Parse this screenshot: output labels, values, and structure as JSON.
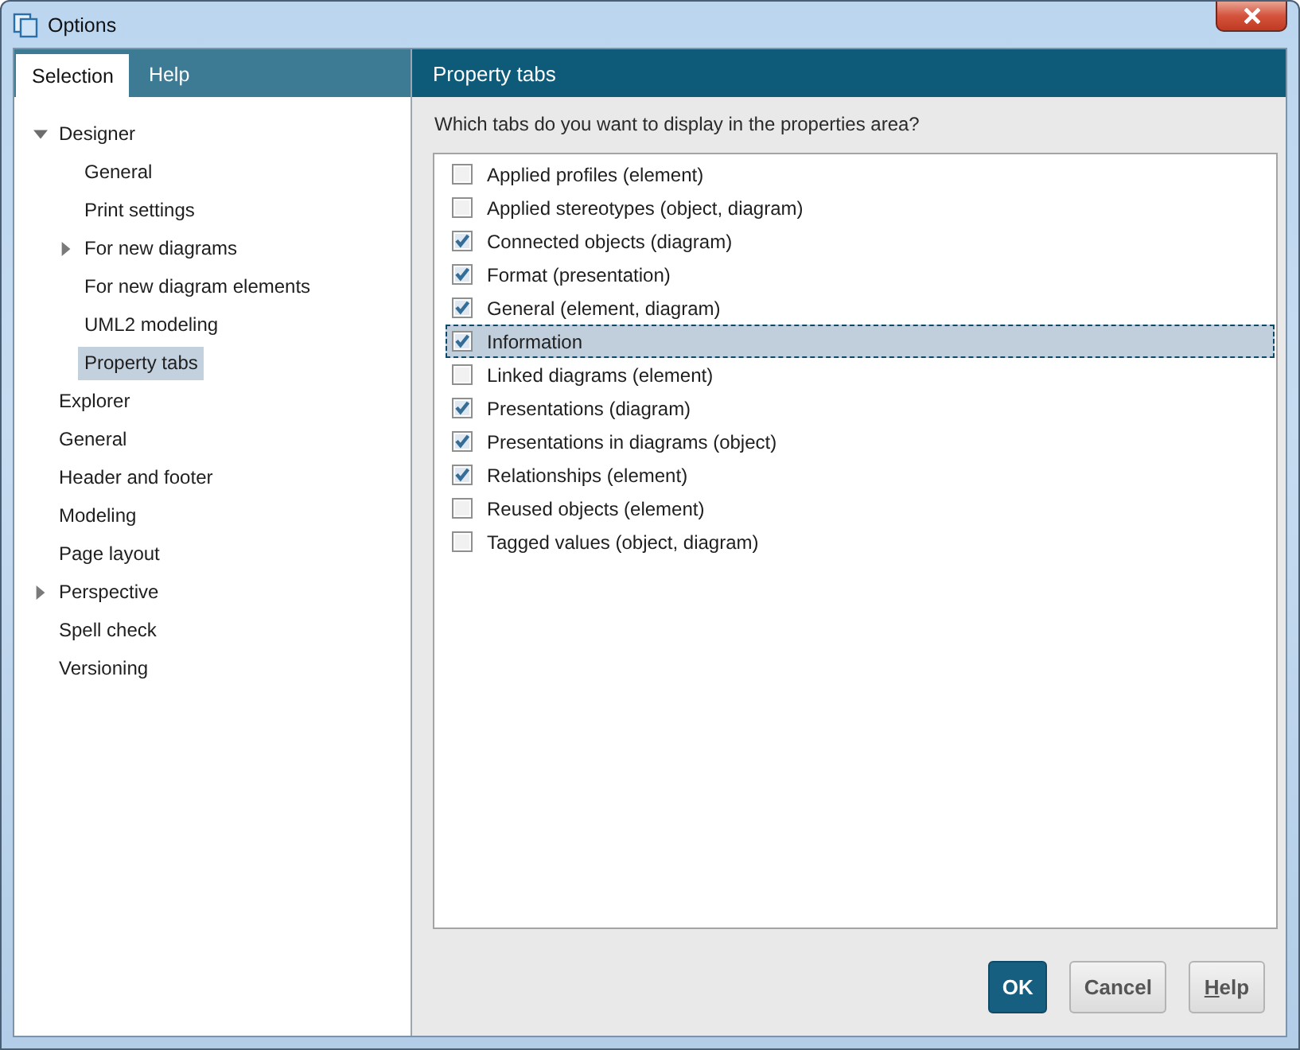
{
  "window": {
    "title": "Options"
  },
  "left_tabs": [
    {
      "label": "Selection",
      "selected": true
    },
    {
      "label": "Help",
      "selected": false
    }
  ],
  "tree": [
    {
      "label": "Designer",
      "kind": "branch",
      "expanded": true,
      "selected": false,
      "children": [
        {
          "label": "General",
          "kind": "leaf",
          "selected": false
        },
        {
          "label": "Print settings",
          "kind": "leaf",
          "selected": false
        },
        {
          "label": "For new diagrams",
          "kind": "branch",
          "expanded": false,
          "selected": false
        },
        {
          "label": "For new diagram elements",
          "kind": "leaf",
          "selected": false
        },
        {
          "label": "UML2 modeling",
          "kind": "leaf",
          "selected": false
        },
        {
          "label": "Property tabs",
          "kind": "leaf",
          "selected": true
        }
      ]
    },
    {
      "label": "Explorer",
      "kind": "leaf",
      "selected": false
    },
    {
      "label": "General",
      "kind": "leaf",
      "selected": false
    },
    {
      "label": "Header and footer",
      "kind": "leaf",
      "selected": false
    },
    {
      "label": "Modeling",
      "kind": "leaf",
      "selected": false
    },
    {
      "label": "Page layout",
      "kind": "leaf",
      "selected": false
    },
    {
      "label": "Perspective",
      "kind": "branch",
      "expanded": false,
      "selected": false
    },
    {
      "label": "Spell check",
      "kind": "leaf",
      "selected": false
    },
    {
      "label": "Versioning",
      "kind": "leaf",
      "selected": false
    }
  ],
  "panel": {
    "title": "Property tabs",
    "prompt": "Which tabs do you want to display in the properties area?",
    "items": [
      {
        "label": "Applied profiles (element)",
        "checked": false,
        "selected": false
      },
      {
        "label": "Applied stereotypes (object, diagram)",
        "checked": false,
        "selected": false
      },
      {
        "label": "Connected objects (diagram)",
        "checked": true,
        "selected": false
      },
      {
        "label": "Format (presentation)",
        "checked": true,
        "selected": false
      },
      {
        "label": "General (element, diagram)",
        "checked": true,
        "selected": false
      },
      {
        "label": "Information",
        "checked": true,
        "selected": true
      },
      {
        "label": "Linked diagrams (element)",
        "checked": false,
        "selected": false
      },
      {
        "label": "Presentations (diagram)",
        "checked": true,
        "selected": false
      },
      {
        "label": "Presentations in diagrams (object)",
        "checked": true,
        "selected": false
      },
      {
        "label": "Relationships (element)",
        "checked": true,
        "selected": false
      },
      {
        "label": "Reused objects (element)",
        "checked": false,
        "selected": false
      },
      {
        "label": "Tagged values (object, diagram)",
        "checked": false,
        "selected": false
      }
    ]
  },
  "buttons": [
    {
      "label": "OK",
      "kind": "default",
      "access_key_underlined": false
    },
    {
      "label": "Cancel",
      "kind": "normal",
      "access_key_underlined": false
    },
    {
      "label": "Help",
      "kind": "normal",
      "access_key_underlined": true
    }
  ]
}
